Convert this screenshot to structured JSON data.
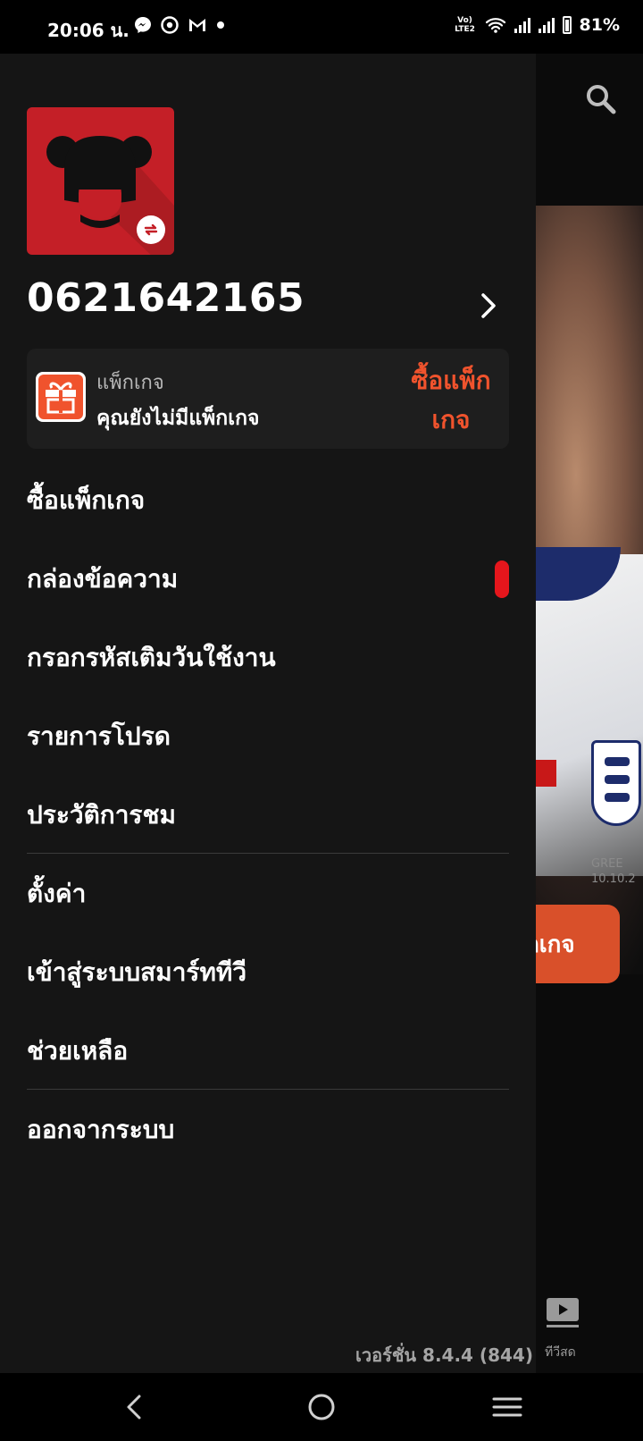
{
  "status_bar": {
    "time": "20:06 น.",
    "notifications": [
      "messenger-icon",
      "chrome-icon",
      "gmail-icon",
      "dot-icon"
    ],
    "network_label": "Vo) LTE2",
    "battery": "81%"
  },
  "drawer": {
    "phone_number": "0621642165",
    "package_card": {
      "title": "แพ็กเกจ",
      "subtitle": "คุณยังไม่มีแพ็กเกจ",
      "buy_label": "ซื้อแพ็กเกจ"
    },
    "menu": [
      {
        "label": "ซื้อแพ็กเกจ"
      },
      {
        "label": "กล่องข้อความ",
        "badge": true
      },
      {
        "label": "กรอกรหัสเติมวันใช้งาน"
      },
      {
        "label": "รายการโปรด"
      },
      {
        "label": "ประวัติการชม"
      },
      {
        "label": "ตั้งค่า"
      },
      {
        "label": "เข้าสู่ระบบสมาร์ททีวี"
      },
      {
        "label": "ช่วยเหลือ"
      },
      {
        "label": "ออกจากระบบ"
      }
    ],
    "version": "เวอร์ชั่น 8.4.4 (844)"
  },
  "background": {
    "cta_partial": "กเกจ",
    "crest_text": "GREE 10.10.2",
    "live_tab_label": "ทีวีสด"
  },
  "colors": {
    "accent": "#f0532d",
    "avatar_bg": "#c41f27",
    "badge": "#e5161c",
    "drawer_bg": "#151515",
    "card_bg": "#1e1e1e"
  }
}
